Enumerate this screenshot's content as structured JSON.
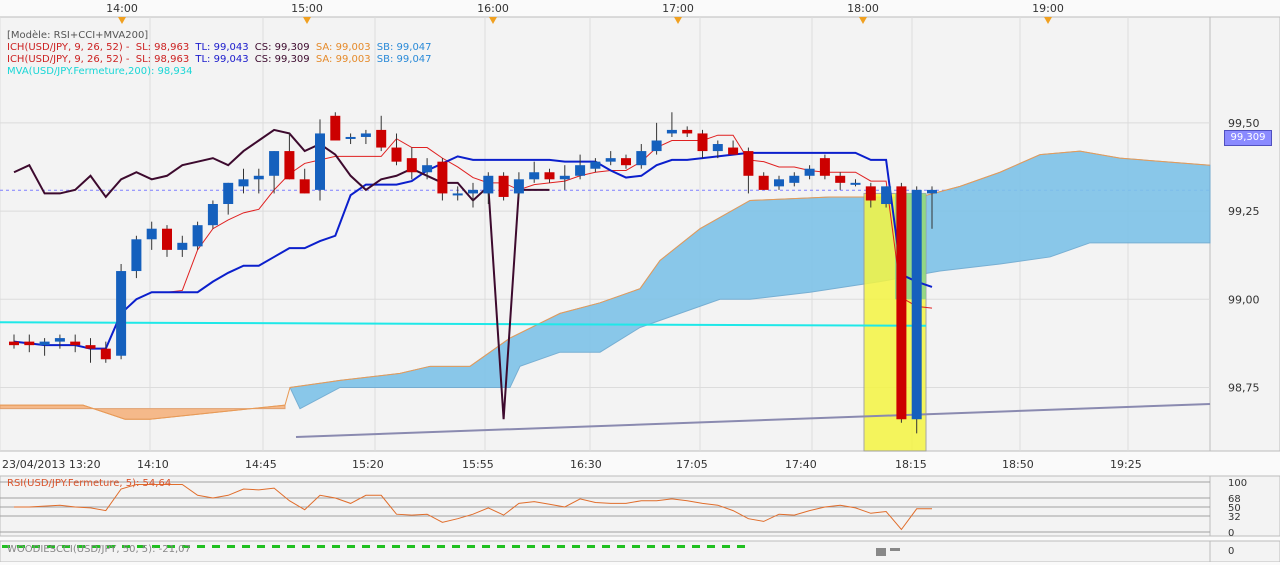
{
  "legend": {
    "model": "[Modèle: RSI+CCI+MVA200]",
    "ichimoku_1": {
      "name": "ICH(USD/JPY, 9, 26, 52) -",
      "sl": "SL: 98,963",
      "tl": "TL: 99,043",
      "cs": "CS: 99,309",
      "sa": "SA: 99,003",
      "sb": "SB: 99,047"
    },
    "ichimoku_2": {
      "name": "ICH(USD/JPY, 9, 26, 52) -",
      "sl": "SL: 98,963",
      "tl": "TL: 99,043",
      "cs": "CS: 99,309",
      "sa": "SA: 99,003",
      "sb": "SB: 99,047"
    },
    "mva": "MVA(USD/JPY.Fermeture,200): 98,934"
  },
  "rsi_label": "RSI(USD/JPY.Fermeture, 5): 54,64",
  "cci_label": "WOODIESCCI(USD/JPY, 50, 5): -21,07",
  "current_price_label": "99,309",
  "colors": {
    "bull": "#1560bd",
    "bear": "#cc0000",
    "tenkan": "#e02020",
    "kijun": "#0b1fcc",
    "chikou": "#3d0a2e",
    "mva": "#1ee8e8",
    "cloud_bull": "#7ec3e8",
    "cloud_bear": "#f5b98a",
    "highlight": "#f5f542",
    "rsi": "#e06d2b",
    "cci": "#20c020"
  },
  "chart_data": {
    "type": "candlestick",
    "instrument": "USD/JPY",
    "top_axis_labels": [
      "14:00",
      "15:00",
      "16:00",
      "17:00",
      "18:00",
      "19:00"
    ],
    "bottom_axis_labels": [
      "23/04/2013 13:20",
      "14:10",
      "14:45",
      "15:20",
      "15:55",
      "16:30",
      "17:05",
      "17:40",
      "18:15",
      "18:50",
      "19:25"
    ],
    "y_ticks": [
      "99,50",
      "99,25",
      "99,00",
      "98,75"
    ],
    "ylim": [
      98.57,
      99.8
    ],
    "candles": [
      {
        "o": 98.88,
        "h": 98.9,
        "l": 98.86,
        "c": 98.87
      },
      {
        "o": 98.88,
        "h": 98.9,
        "l": 98.85,
        "c": 98.87
      },
      {
        "o": 98.87,
        "h": 98.89,
        "l": 98.84,
        "c": 98.88
      },
      {
        "o": 98.88,
        "h": 98.9,
        "l": 98.86,
        "c": 98.89
      },
      {
        "o": 98.88,
        "h": 98.9,
        "l": 98.85,
        "c": 98.87
      },
      {
        "o": 98.87,
        "h": 98.89,
        "l": 98.82,
        "c": 98.86
      },
      {
        "o": 98.86,
        "h": 98.88,
        "l": 98.82,
        "c": 98.83
      },
      {
        "o": 98.84,
        "h": 99.1,
        "l": 98.83,
        "c": 99.08
      },
      {
        "o": 99.08,
        "h": 99.18,
        "l": 99.06,
        "c": 99.17
      },
      {
        "o": 99.17,
        "h": 99.22,
        "l": 99.14,
        "c": 99.2
      },
      {
        "o": 99.2,
        "h": 99.21,
        "l": 99.12,
        "c": 99.14
      },
      {
        "o": 99.14,
        "h": 99.18,
        "l": 99.12,
        "c": 99.16
      },
      {
        "o": 99.15,
        "h": 99.22,
        "l": 99.14,
        "c": 99.21
      },
      {
        "o": 99.21,
        "h": 99.28,
        "l": 99.2,
        "c": 99.27
      },
      {
        "o": 99.27,
        "h": 99.33,
        "l": 99.24,
        "c": 99.33
      },
      {
        "o": 99.32,
        "h": 99.37,
        "l": 99.3,
        "c": 99.34
      },
      {
        "o": 99.34,
        "h": 99.37,
        "l": 99.3,
        "c": 99.35
      },
      {
        "o": 99.35,
        "h": 99.42,
        "l": 99.3,
        "c": 99.42
      },
      {
        "o": 99.42,
        "h": 99.47,
        "l": 99.34,
        "c": 99.34
      },
      {
        "o": 99.34,
        "h": 99.37,
        "l": 99.3,
        "c": 99.3
      },
      {
        "o": 99.31,
        "h": 99.51,
        "l": 99.28,
        "c": 99.47
      },
      {
        "o": 99.52,
        "h": 99.53,
        "l": 99.45,
        "c": 99.45
      },
      {
        "o": 99.46,
        "h": 99.47,
        "l": 99.44,
        "c": 99.46
      },
      {
        "o": 99.46,
        "h": 99.48,
        "l": 99.44,
        "c": 99.47
      },
      {
        "o": 99.48,
        "h": 99.52,
        "l": 99.42,
        "c": 99.43
      },
      {
        "o": 99.43,
        "h": 99.47,
        "l": 99.38,
        "c": 99.39
      },
      {
        "o": 99.4,
        "h": 99.43,
        "l": 99.34,
        "c": 99.36
      },
      {
        "o": 99.36,
        "h": 99.4,
        "l": 99.34,
        "c": 99.38
      },
      {
        "o": 99.39,
        "h": 99.4,
        "l": 99.28,
        "c": 99.3
      },
      {
        "o": 99.3,
        "h": 99.32,
        "l": 99.28,
        "c": 99.3
      },
      {
        "o": 99.3,
        "h": 99.33,
        "l": 99.26,
        "c": 99.31
      },
      {
        "o": 99.3,
        "h": 99.36,
        "l": 99.27,
        "c": 99.35
      },
      {
        "o": 99.35,
        "h": 99.36,
        "l": 99.28,
        "c": 99.29
      },
      {
        "o": 99.3,
        "h": 99.36,
        "l": 99.29,
        "c": 99.34
      },
      {
        "o": 99.34,
        "h": 99.39,
        "l": 99.33,
        "c": 99.36
      },
      {
        "o": 99.36,
        "h": 99.37,
        "l": 99.33,
        "c": 99.34
      },
      {
        "o": 99.34,
        "h": 99.38,
        "l": 99.31,
        "c": 99.35
      },
      {
        "o": 99.35,
        "h": 99.41,
        "l": 99.34,
        "c": 99.38
      },
      {
        "o": 99.37,
        "h": 99.4,
        "l": 99.36,
        "c": 99.39
      },
      {
        "o": 99.39,
        "h": 99.42,
        "l": 99.38,
        "c": 99.4
      },
      {
        "o": 99.4,
        "h": 99.41,
        "l": 99.37,
        "c": 99.38
      },
      {
        "o": 99.38,
        "h": 99.44,
        "l": 99.37,
        "c": 99.42
      },
      {
        "o": 99.42,
        "h": 99.5,
        "l": 99.41,
        "c": 99.45
      },
      {
        "o": 99.47,
        "h": 99.53,
        "l": 99.46,
        "c": 99.48
      },
      {
        "o": 99.48,
        "h": 99.49,
        "l": 99.46,
        "c": 99.47
      },
      {
        "o": 99.47,
        "h": 99.48,
        "l": 99.4,
        "c": 99.42
      },
      {
        "o": 99.42,
        "h": 99.45,
        "l": 99.4,
        "c": 99.44
      },
      {
        "o": 99.43,
        "h": 99.45,
        "l": 99.41,
        "c": 99.41
      },
      {
        "o": 99.42,
        "h": 99.43,
        "l": 99.3,
        "c": 99.35
      },
      {
        "o": 99.35,
        "h": 99.36,
        "l": 99.31,
        "c": 99.31
      },
      {
        "o": 99.32,
        "h": 99.35,
        "l": 99.31,
        "c": 99.34
      },
      {
        "o": 99.33,
        "h": 99.36,
        "l": 99.32,
        "c": 99.35
      },
      {
        "o": 99.35,
        "h": 99.38,
        "l": 99.34,
        "c": 99.37
      },
      {
        "o": 99.4,
        "h": 99.41,
        "l": 99.34,
        "c": 99.35
      },
      {
        "o": 99.35,
        "h": 99.36,
        "l": 99.31,
        "c": 99.33
      },
      {
        "o": 99.33,
        "h": 99.34,
        "l": 99.32,
        "c": 99.33
      },
      {
        "o": 99.32,
        "h": 99.33,
        "l": 99.26,
        "c": 99.28
      },
      {
        "o": 99.27,
        "h": 99.32,
        "l": 99.26,
        "c": 99.32
      },
      {
        "o": 99.32,
        "h": 99.33,
        "l": 98.65,
        "c": 98.66
      },
      {
        "o": 98.66,
        "h": 99.32,
        "l": 98.62,
        "c": 99.31
      },
      {
        "o": 99.3,
        "h": 99.32,
        "l": 99.2,
        "c": 99.31
      }
    ],
    "mva_value": 98.93,
    "price_line": 99.309,
    "rsi_levels": [
      "100",
      "68",
      "50",
      "32",
      "0"
    ],
    "cci_levels": [
      "0"
    ]
  }
}
